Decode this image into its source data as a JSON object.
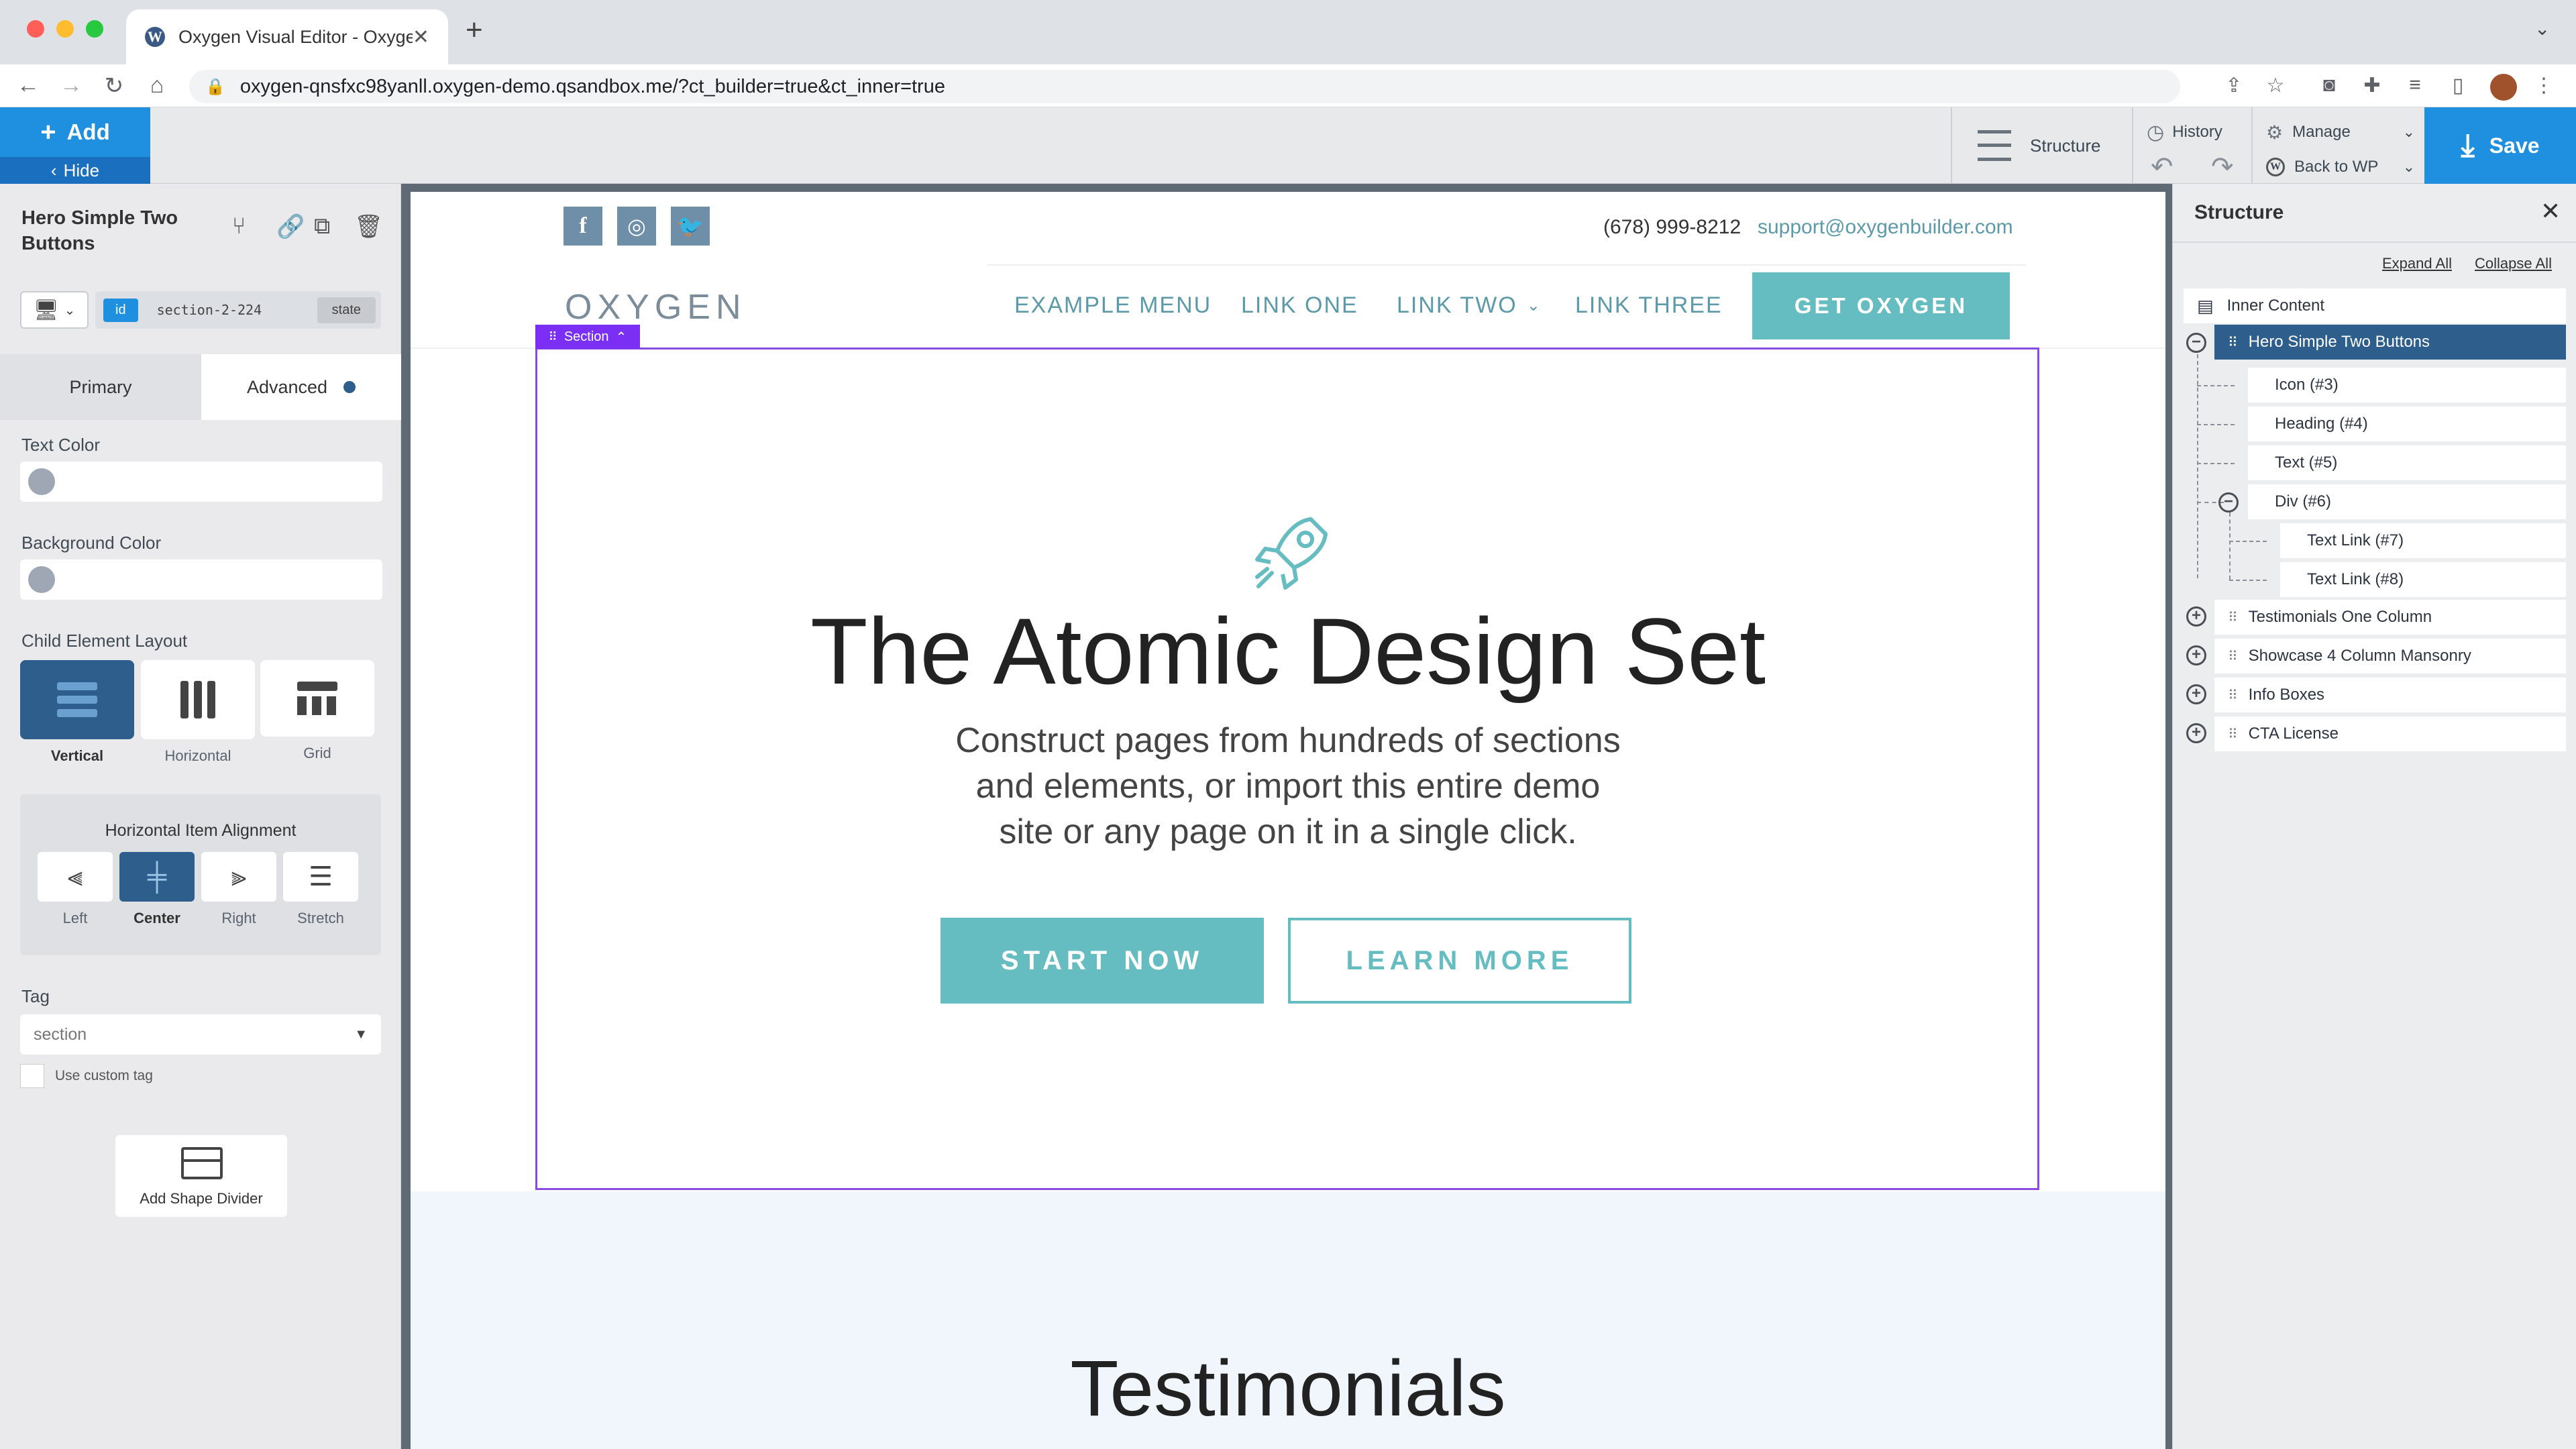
{
  "browser": {
    "tab_title": "Oxygen Visual Editor - Oxygen",
    "url": "oxygen-qnsfxc98yanll.oxygen-demo.qsandbox.me/?ct_builder=true&ct_inner=true"
  },
  "toolbar": {
    "add_label": "Add",
    "hide_label": "Hide",
    "structure_label": "Structure",
    "history_label": "History",
    "manage_label": "Manage",
    "back_to_wp_label": "Back to WP",
    "save_label": "Save"
  },
  "left_panel": {
    "element_title": "Hero Simple Two Buttons",
    "id_badge": "id",
    "id_value": "section-2-224",
    "state_label": "state",
    "tab_primary": "Primary",
    "tab_advanced": "Advanced",
    "text_color_label": "Text Color",
    "background_color_label": "Background Color",
    "child_layout_label": "Child Element Layout",
    "layout_options": [
      "Vertical",
      "Horizontal",
      "Grid"
    ],
    "alignment_label": "Horizontal Item Alignment",
    "alignment_options": [
      "Left",
      "Center",
      "Right",
      "Stretch"
    ],
    "tag_label": "Tag",
    "tag_value": "section",
    "custom_tag_label": "Use custom tag",
    "shape_divider_label": "Add Shape Divider"
  },
  "site": {
    "phone": "(678) 999-8212",
    "email": "support@oxygenbuilder.com",
    "logo": "OXYGEN",
    "menu": [
      "EXAMPLE MENU",
      "LINK ONE",
      "LINK TWO",
      "LINK THREE"
    ],
    "cta": "GET OXYGEN",
    "section_tag": "Section",
    "hero_heading": "The Atomic Design Set",
    "hero_text_1": "Construct pages from hundreds of sections",
    "hero_text_2": "and elements, or import this entire demo",
    "hero_text_3": "site or any page on it in a single click.",
    "btn_start": "START NOW",
    "btn_learn": "LEARN MORE",
    "testimonials_heading": "Testimonials"
  },
  "structure": {
    "title": "Structure",
    "expand_all": "Expand All",
    "collapse_all": "Collapse All",
    "root": "Inner Content",
    "selected": "Hero Simple Two Buttons",
    "children": [
      "Icon (#3)",
      "Heading (#4)",
      "Text (#5)",
      "Div (#6)"
    ],
    "div_children": [
      "Text Link (#7)",
      "Text Link (#8)"
    ],
    "siblings": [
      "Testimonials One Column",
      "Showcase 4 Column Mansonry",
      "Info Boxes",
      "CTA License"
    ]
  },
  "colors": {
    "accent": "#66bdc1",
    "builder_blue": "#1f90e0",
    "selected_navy": "#2d5e8c",
    "section_purple": "#7b2ff5"
  }
}
